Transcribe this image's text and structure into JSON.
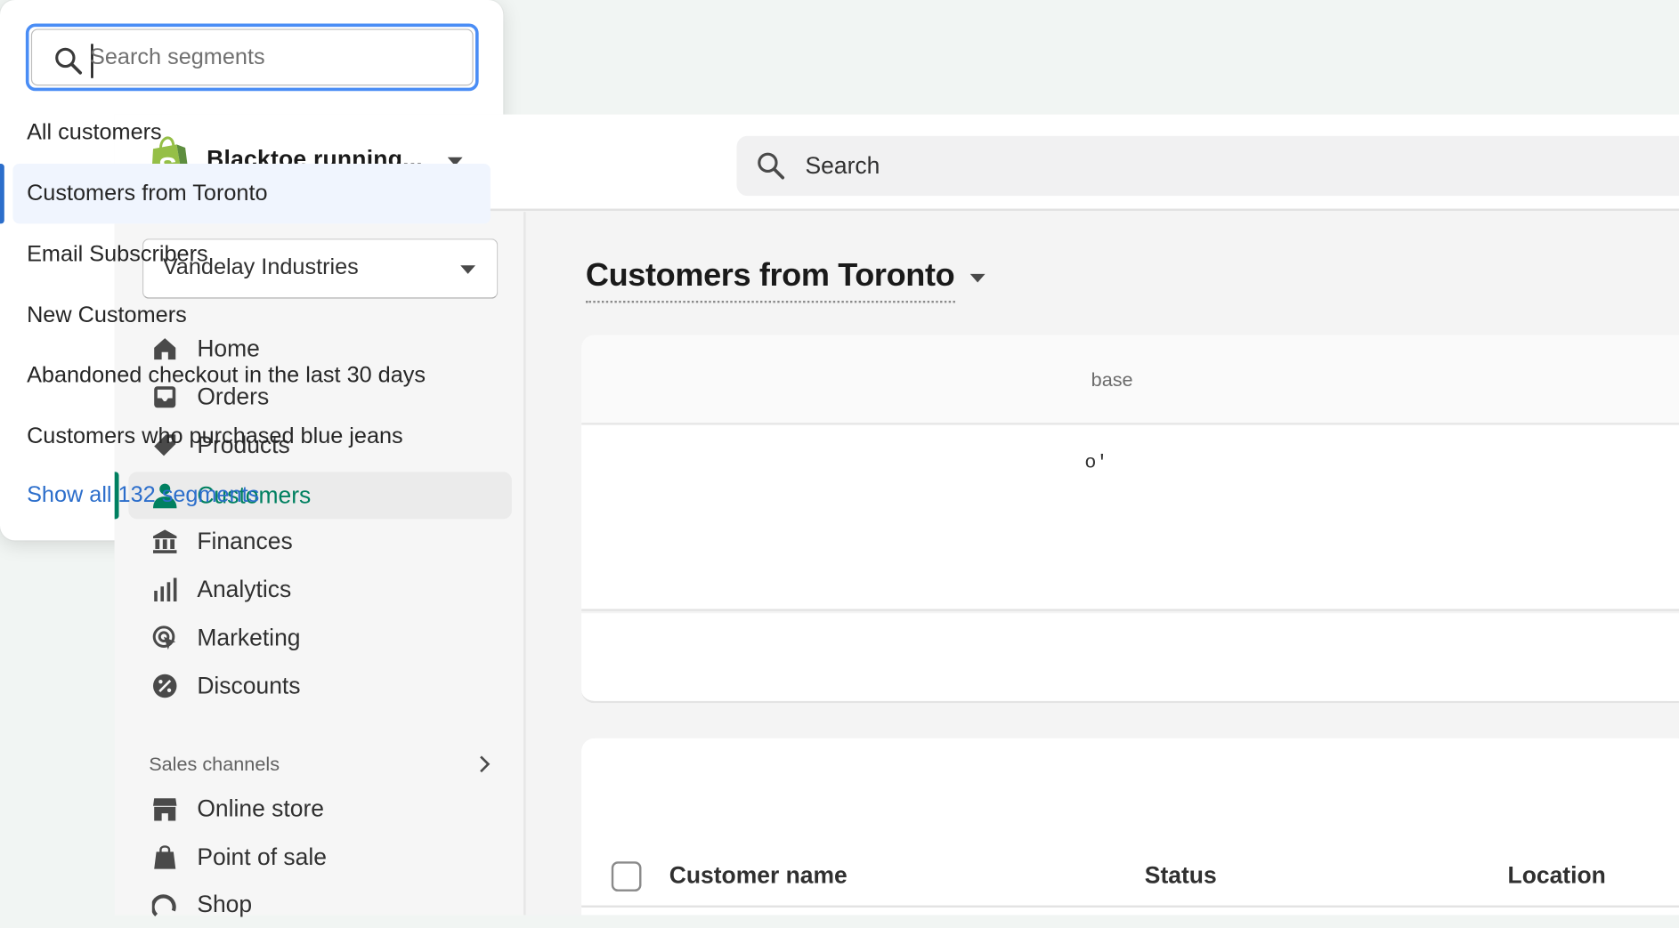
{
  "topbar": {
    "store_name": "Blacktoe running...",
    "search_placeholder": "Search"
  },
  "sidebar": {
    "store_selector": "Vandelay Industries",
    "items": [
      {
        "label": "Home",
        "icon": "home-icon"
      },
      {
        "label": "Orders",
        "icon": "orders-icon"
      },
      {
        "label": "Products",
        "icon": "tag-icon"
      },
      {
        "label": "Customers",
        "icon": "person-icon",
        "active": true
      },
      {
        "label": "Finances",
        "icon": "bank-icon"
      },
      {
        "label": "Analytics",
        "icon": "bar-chart-icon"
      },
      {
        "label": "Marketing",
        "icon": "target-icon"
      },
      {
        "label": "Discounts",
        "icon": "discount-icon"
      }
    ],
    "sales_channels_label": "Sales channels",
    "channels": [
      {
        "label": "Online store",
        "icon": "store-icon"
      },
      {
        "label": "Point of sale",
        "icon": "pos-bag-icon"
      },
      {
        "label": "Shop",
        "icon": "shop-icon"
      }
    ]
  },
  "main": {
    "title": "Customers from Toronto",
    "partial_text_1": "base",
    "partial_text_2": "o'",
    "table_headers": [
      "Customer name",
      "Status",
      "Location"
    ]
  },
  "segments_popover": {
    "search_placeholder": "Search segments",
    "items": [
      "All customers",
      "Customers from Toronto",
      "Email Subscribers",
      "New Customers",
      "Abandoned checkout in the last 30 days",
      "Customers who purchased blue jeans"
    ],
    "selected": "Customers from Toronto",
    "show_all": "Show all 132 segments"
  },
  "colors": {
    "brand_green": "#008060",
    "link_blue": "#2c6ecb",
    "focus_blue": "#4a8df5",
    "logo_green": "#95bf47"
  }
}
